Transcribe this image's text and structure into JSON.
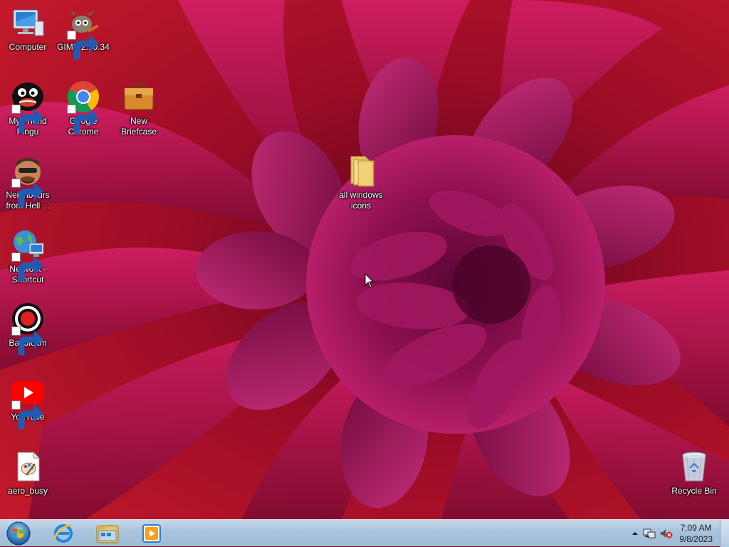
{
  "desktop": {
    "icons": [
      {
        "label": "Computer",
        "icon": "computer-icon",
        "shortcut": false
      },
      {
        "label": "GIMP 2.10.34",
        "icon": "gimp-icon",
        "shortcut": true
      },
      {
        "label": "My Friend Pingu",
        "icon": "pingu-icon",
        "shortcut": true
      },
      {
        "label": "Google Chrome",
        "icon": "chrome-icon",
        "shortcut": true
      },
      {
        "label": "New Briefcase",
        "icon": "briefcase-icon",
        "shortcut": false
      },
      {
        "label": "Neighbours from Hell ...",
        "icon": "neighbours-icon",
        "shortcut": true
      },
      {
        "label": "all windows icons",
        "icon": "folder-icon",
        "shortcut": false
      },
      {
        "label": "Network - Shortcut",
        "icon": "network-icon",
        "shortcut": true
      },
      {
        "label": "Bandicam",
        "icon": "bandicam-icon",
        "shortcut": true
      },
      {
        "label": "YouTube",
        "icon": "youtube-icon",
        "shortcut": true
      },
      {
        "label": "aero_busy",
        "icon": "file-icon",
        "shortcut": false
      },
      {
        "label": "Recycle Bin",
        "icon": "recycle-bin-icon",
        "shortcut": false
      }
    ]
  },
  "taskbar": {
    "start": {
      "icon": "windows-start-icon"
    },
    "pinned": [
      {
        "icon": "internet-explorer-icon"
      },
      {
        "icon": "file-explorer-icon"
      },
      {
        "icon": "media-player-icon"
      }
    ],
    "tray": {
      "icons": [
        "show-hidden-icons-arrow",
        "network-tray-icon",
        "volume-muted-icon"
      ],
      "time": "7:09 AM",
      "date": "9/8/2023"
    }
  },
  "colors": {
    "wallpaper_base": "#8a0b22",
    "petal": "#a3145a",
    "taskbar": "#a9c3dc"
  }
}
